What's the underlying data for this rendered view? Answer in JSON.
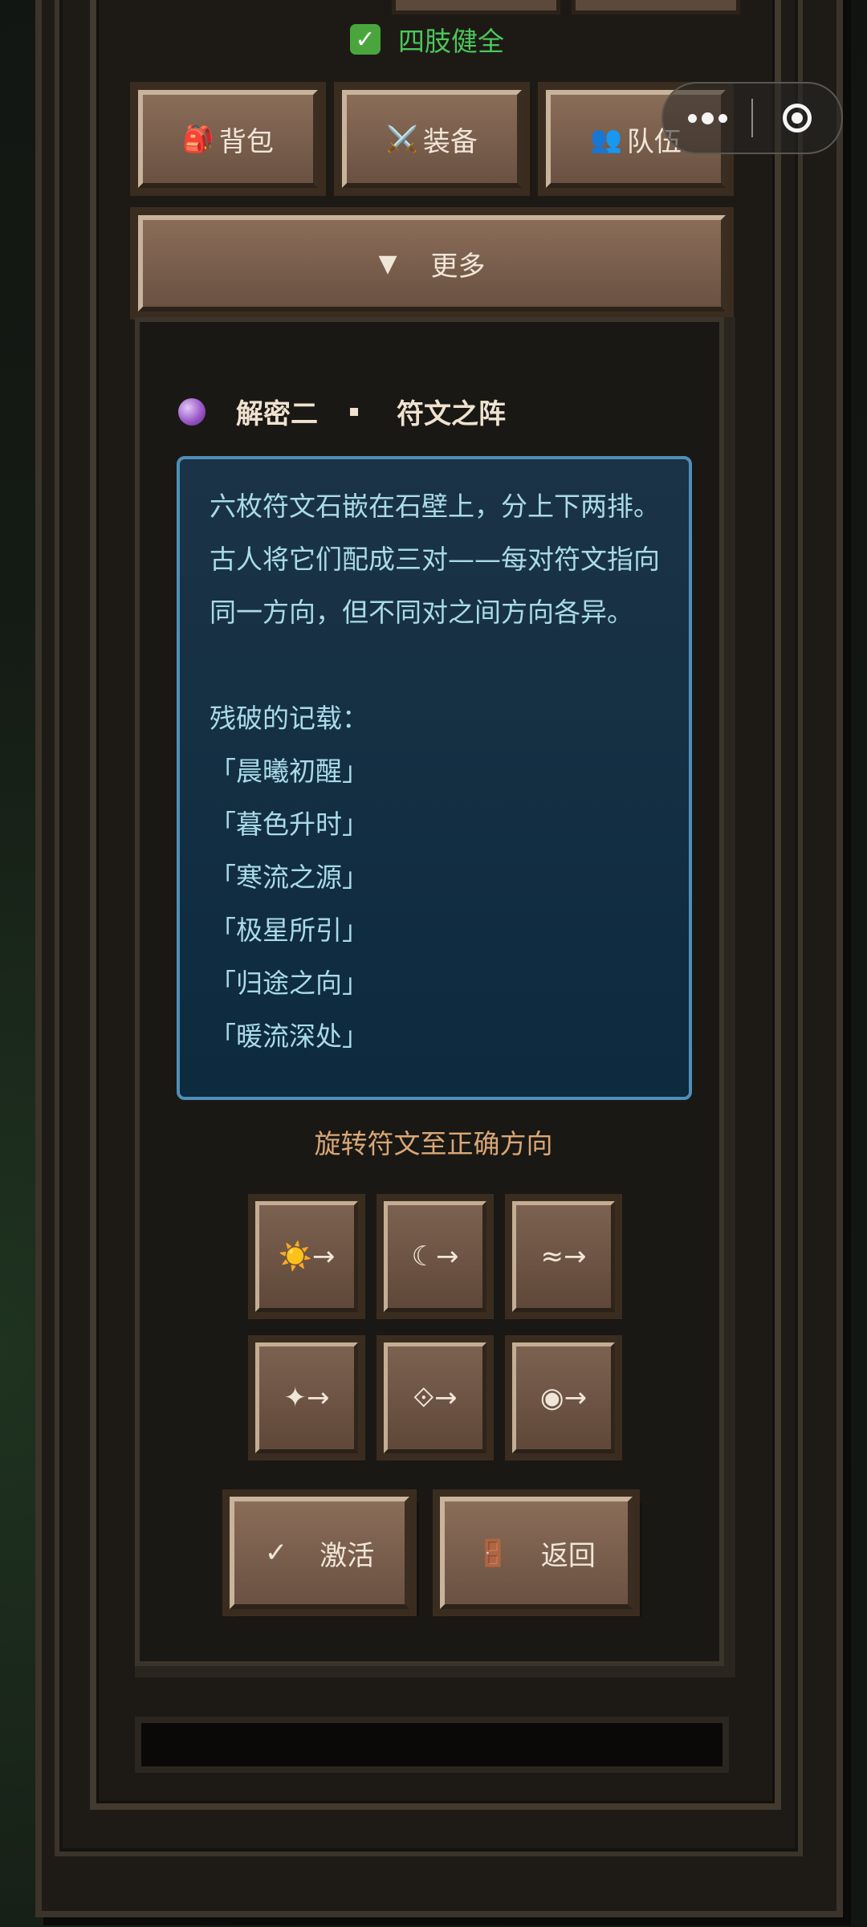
{
  "status": {
    "icon": "check-mark-icon",
    "text": "四肢健全"
  },
  "nav": {
    "bag": {
      "icon": "🎒",
      "label": "背包"
    },
    "equip": {
      "icon": "⚔️",
      "label": "装备"
    },
    "team": {
      "icon": "👥",
      "label": "队伍"
    },
    "more": {
      "icon": "▼",
      "label": "更多"
    }
  },
  "capsule": {
    "menu_icon": "more-dots-icon",
    "close_icon": "target-circle-icon"
  },
  "puzzle": {
    "title_left": "解密二",
    "title_right": "符文之阵",
    "lines": [
      "六枚符文石嵌在石壁上，分上下两排。",
      "古人将它们配成三对——每对符文指向",
      "同一方向，但不同对之间方向各异。",
      "",
      "残破的记载：",
      "「晨曦初醒」",
      "「暮色升时」",
      "「寒流之源」",
      "「极星所引」",
      "「归途之向」",
      "「暖流深处」"
    ],
    "hint": "旋转符文至正确方向",
    "runes": [
      "☀️→",
      "☾→",
      "≈→",
      "✦→",
      "⟐→",
      "◉→"
    ],
    "activate": {
      "icon": "✓",
      "label": "激活"
    },
    "back": {
      "icon": "🚪",
      "label": "返回"
    }
  },
  "colors": {
    "status_green": "#4cc65a",
    "story_text": "#a9dbe8",
    "story_border": "#4f8fb8",
    "hint": "#d9a776",
    "button_face": "#7c6150"
  }
}
